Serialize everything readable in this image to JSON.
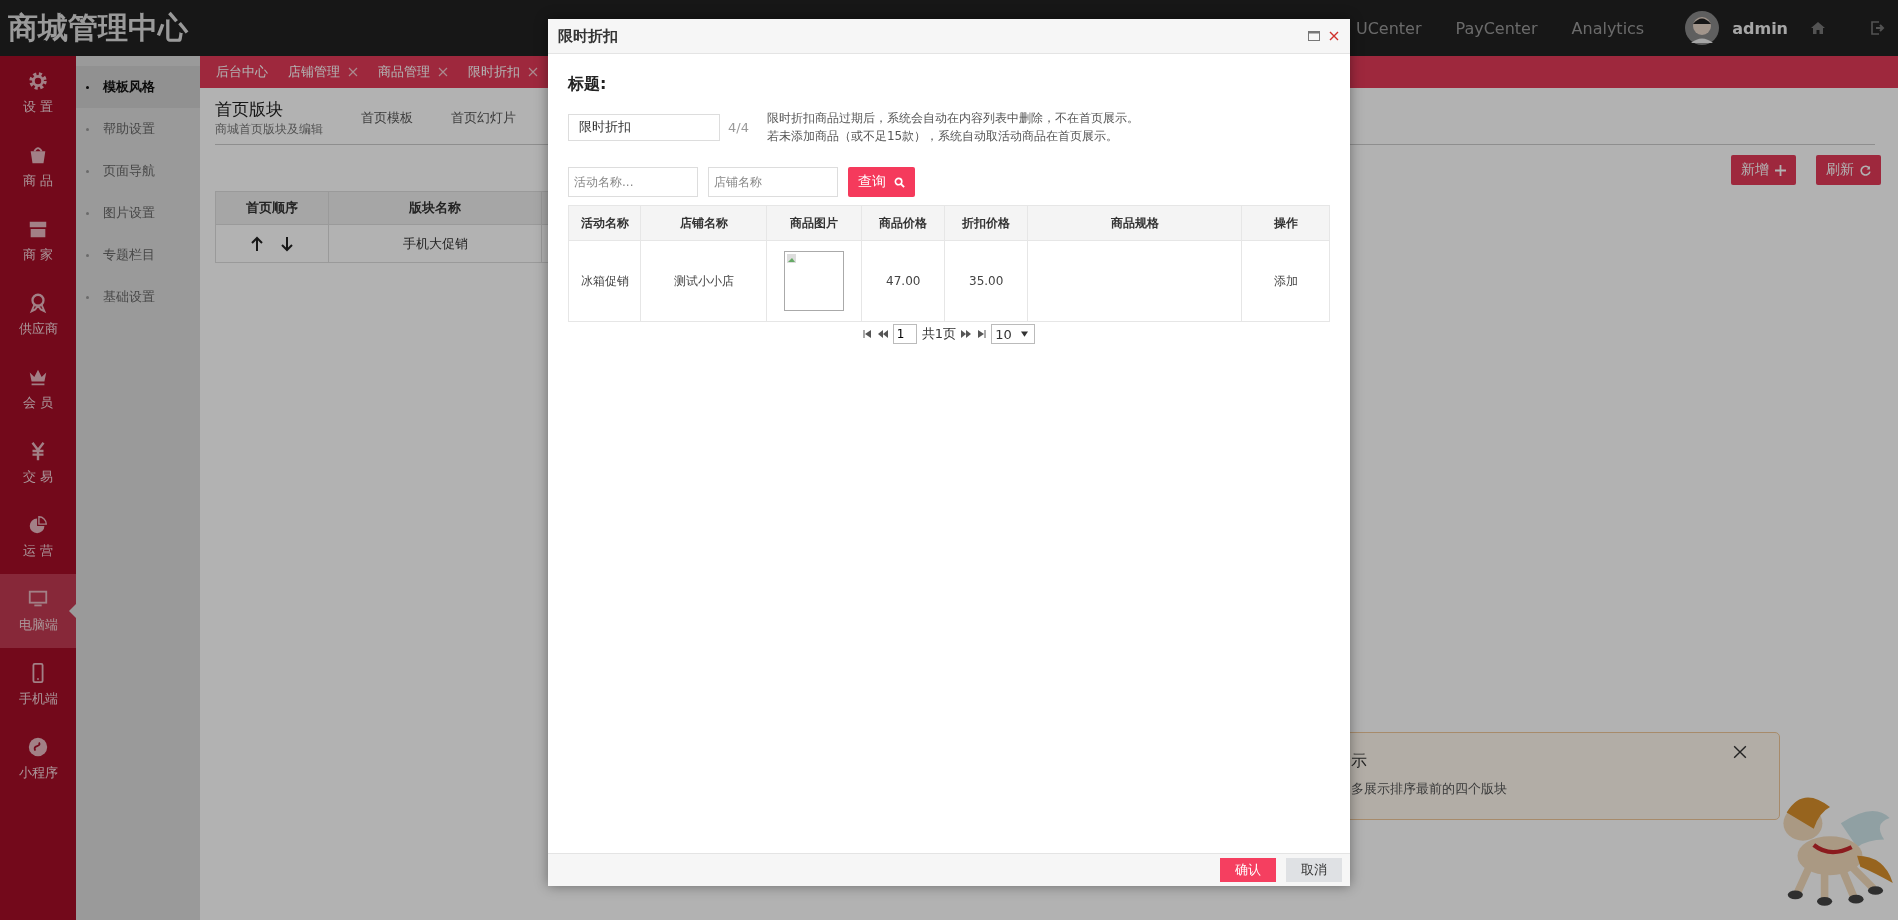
{
  "header": {
    "logo": "商城管理中心",
    "nav": [
      "UCenter",
      "PayCenter",
      "Analytics"
    ],
    "user": "admin"
  },
  "sidebar": {
    "items": [
      {
        "label": "设 置",
        "selected": false
      },
      {
        "label": "商 品",
        "selected": false
      },
      {
        "label": "商 家",
        "selected": false
      },
      {
        "label": "供应商",
        "selected": false
      },
      {
        "label": "会 员",
        "selected": false
      },
      {
        "label": "交 易",
        "selected": false
      },
      {
        "label": "运 营",
        "selected": false
      },
      {
        "label": "电脑端",
        "selected": true
      },
      {
        "label": "手机端",
        "selected": false
      },
      {
        "label": "小程序",
        "selected": false
      }
    ]
  },
  "subnav": {
    "items": [
      {
        "label": "模板风格",
        "selected": true
      },
      {
        "label": "帮助设置",
        "selected": false
      },
      {
        "label": "页面导航",
        "selected": false
      },
      {
        "label": "图片设置",
        "selected": false
      },
      {
        "label": "专题栏目",
        "selected": false
      },
      {
        "label": "基础设置",
        "selected": false
      }
    ]
  },
  "tabs": [
    {
      "label": "后台中心",
      "closable": false
    },
    {
      "label": "店铺管理",
      "closable": true
    },
    {
      "label": "商品管理",
      "closable": true
    },
    {
      "label": "限时折扣",
      "closable": true
    }
  ],
  "page": {
    "title": "首页版块",
    "subtitle": "商城首页版块及编辑",
    "subtabs": [
      "首页模板",
      "首页幻灯片"
    ],
    "buttons": [
      "新增",
      "刷新"
    ],
    "table": {
      "columns": [
        "首页顺序",
        "版块名称"
      ],
      "rows": [
        {
          "name": "手机大促销"
        }
      ]
    }
  },
  "notice": {
    "title": "示",
    "text": "多展示排序最前的四个版块"
  },
  "modal": {
    "title": "限时折扣",
    "field_label": "标题:",
    "title_value": "限时折扣",
    "count": "4/4",
    "notes": [
      "限时折扣商品过期后，系统会自动在内容列表中删除，不在首页展示。",
      "若未添加商品（或不足15款），系统自动取活动商品在首页展示。"
    ],
    "search": [
      {
        "placeholder": "活动名称..."
      },
      {
        "placeholder": "店铺名称"
      }
    ],
    "search_button": "查询",
    "table": {
      "columns": [
        "活动名称",
        "店铺名称",
        "商品图片",
        "商品价格",
        "折扣价格",
        "商品规格",
        "操作"
      ],
      "rows": [
        {
          "activity": "冰箱促销",
          "shop": "测试小小店",
          "price": "47.00",
          "discount": "35.00",
          "action": "添加"
        }
      ]
    },
    "pager": {
      "page": "1",
      "total": "共1页",
      "size": "10"
    },
    "buttons": [
      "确认",
      "取消"
    ]
  }
}
